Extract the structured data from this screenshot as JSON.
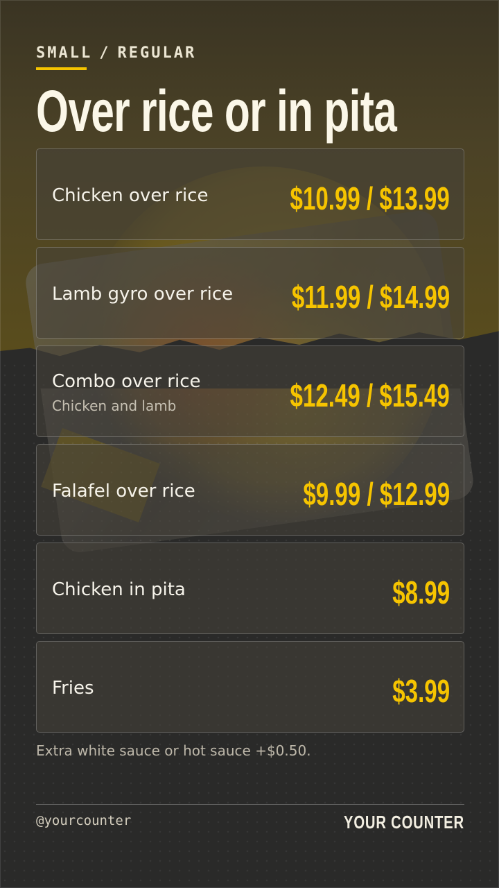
{
  "header": {
    "size_small": "SMALL",
    "separator": "/",
    "size_regular": "REGULAR",
    "title": "Over rice or in pita"
  },
  "menu": {
    "items": [
      {
        "name": "Chicken over rice",
        "desc": "",
        "price": "$10.99 / $13.99"
      },
      {
        "name": "Lamb gyro over rice",
        "desc": "",
        "price": "$11.99 / $14.99"
      },
      {
        "name": "Combo over rice",
        "desc": "Chicken and lamb",
        "price": "$12.49 / $15.49"
      },
      {
        "name": "Falafel over rice",
        "desc": "",
        "price": "$9.99 / $12.99"
      },
      {
        "name": "Chicken in pita",
        "desc": "",
        "price": "$8.99"
      },
      {
        "name": "Fries",
        "desc": "",
        "price": "$3.99"
      }
    ]
  },
  "note": "Extra white sauce or hot sauce +$0.50.",
  "footer": {
    "handle": "@yourcounter",
    "brand": "YOUR COUNTER"
  },
  "colors": {
    "accent": "#f6c400",
    "background": "#2a2a29",
    "text": "#f6f3ea"
  }
}
